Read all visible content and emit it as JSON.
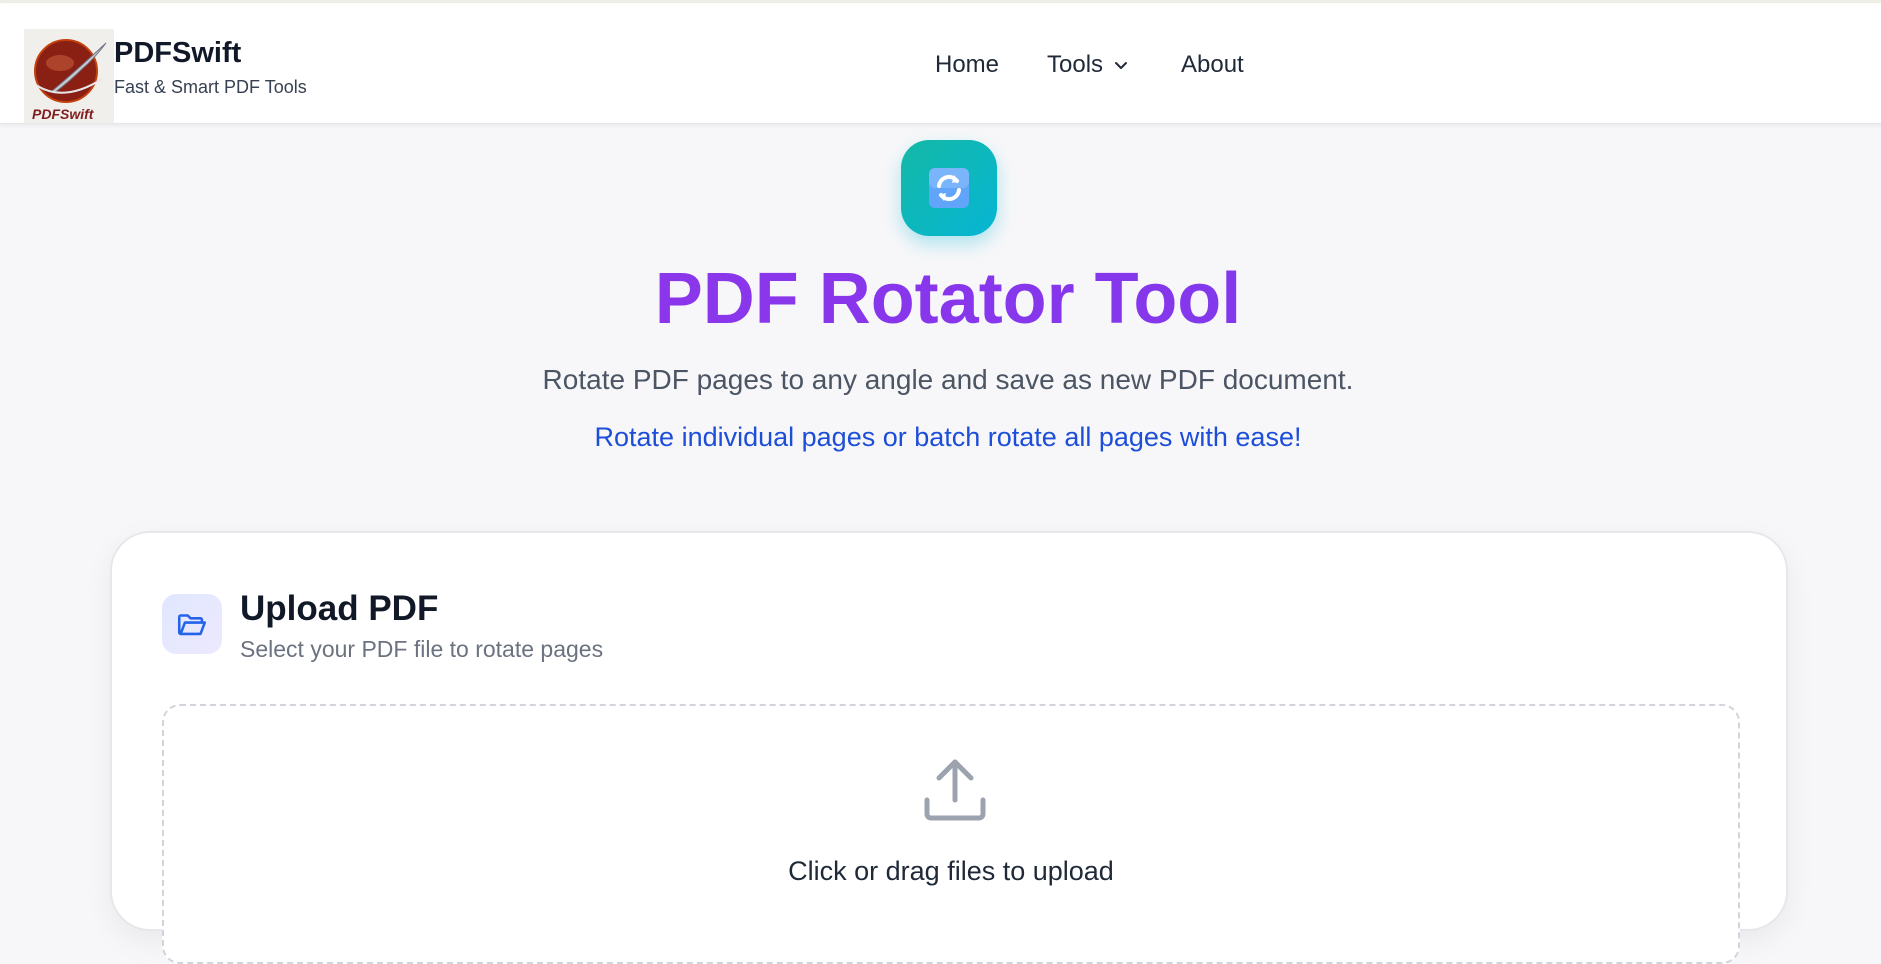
{
  "brand": {
    "name": "PDFSwift",
    "tagline": "Fast & Smart PDF Tools",
    "logo_text": "PDFSwift"
  },
  "nav": {
    "home": "Home",
    "tools": "Tools",
    "about": "About"
  },
  "hero": {
    "icon": "rotate-arrows-icon",
    "title": "PDF Rotator Tool",
    "subtitle": "Rotate PDF pages to any angle and save as new PDF document.",
    "highlight": "Rotate individual pages or batch rotate all pages with ease!"
  },
  "upload": {
    "title": "Upload PDF",
    "subtitle": "Select your PDF file to rotate pages",
    "drop_text": "Click or drag files to upload"
  },
  "colors": {
    "accent_purple": "#8b3dfa",
    "accent_blue": "#1d4ed8",
    "icon_teal": "#14b8a6"
  }
}
